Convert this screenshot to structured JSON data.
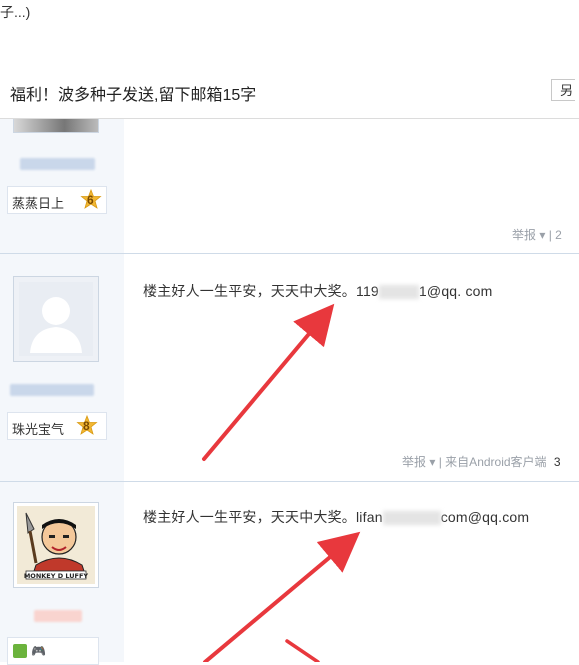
{
  "top_text": "子...)",
  "thread": {
    "title": "福利！波多种子发送,留下邮箱15字",
    "reply_btn": "另"
  },
  "posts": [
    {
      "username": "蒸蒸日上",
      "level": "6",
      "report": "举报",
      "extra": "| 2"
    },
    {
      "username": "珠光宝气",
      "level": "8",
      "content_prefix": "楼主好人一生平安，天天中大奖。119",
      "content_suffix": "1@qq. com",
      "report": "举报",
      "source": "| 来自Android客户端",
      "floor": "3"
    },
    {
      "avatar_caption": "MONKEY D LUFFY",
      "content_prefix": "楼主好人一生平安，天天中大奖。lifan",
      "content_suffix": "com@qq.com"
    }
  ],
  "colors": {
    "arrow": "#e8383d",
    "sidebar": "#f4f7fb",
    "badge_gold": "#f2b733"
  }
}
